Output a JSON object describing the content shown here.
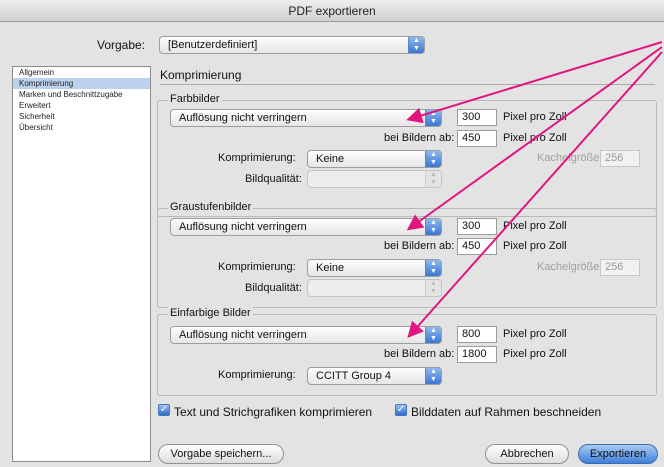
{
  "window": {
    "title": "PDF exportieren"
  },
  "preset": {
    "label": "Vorgabe:",
    "value": "[Benutzerdefiniert]"
  },
  "sidebar": {
    "items": [
      {
        "label": "Allgemein",
        "selected": false
      },
      {
        "label": "Komprimierung",
        "selected": true
      },
      {
        "label": "Marken und Beschnittzugabe",
        "selected": false
      },
      {
        "label": "Erweitert",
        "selected": false
      },
      {
        "label": "Sicherheit",
        "selected": false
      },
      {
        "label": "Übersicht",
        "selected": false
      }
    ]
  },
  "section": {
    "title": "Komprimierung"
  },
  "color_images": {
    "title": "Farbbilder",
    "downsample": "Auflösung nicht verringern",
    "ppi_value": "300",
    "ppi_unit": "Pixel pro Zoll",
    "above_label": "bei Bildern ab:",
    "above_value": "450",
    "above_unit": "Pixel pro Zoll",
    "compression_label": "Komprimierung:",
    "compression_value": "Keine",
    "tile_label": "Kachelgröße:",
    "tile_value": "256",
    "quality_label": "Bildqualität:",
    "quality_value": ""
  },
  "gray_images": {
    "title": "Graustufenbilder",
    "downsample": "Auflösung nicht verringern",
    "ppi_value": "300",
    "ppi_unit": "Pixel pro Zoll",
    "above_label": "bei Bildern ab:",
    "above_value": "450",
    "above_unit": "Pixel pro Zoll",
    "compression_label": "Komprimierung:",
    "compression_value": "Keine",
    "tile_label": "Kachelgröße:",
    "tile_value": "256",
    "quality_label": "Bildqualität:",
    "quality_value": ""
  },
  "mono_images": {
    "title": "Einfarbige Bilder",
    "downsample": "Auflösung nicht verringern",
    "ppi_value": "800",
    "ppi_unit": "Pixel pro Zoll",
    "above_label": "bei Bildern ab:",
    "above_value": "1800",
    "above_unit": "Pixel pro Zoll",
    "compression_label": "Komprimierung:",
    "compression_value": "CCITT Group 4"
  },
  "options": {
    "compress_text": {
      "label": "Text und Strichgrafiken komprimieren",
      "checked": true
    },
    "crop_images": {
      "label": "Bilddaten auf Rahmen beschneiden",
      "checked": true
    }
  },
  "buttons": {
    "save_preset": "Vorgabe speichern...",
    "cancel": "Abbrechen",
    "export": "Exportieren"
  },
  "colors": {
    "accent": "#3f80db",
    "annotation_arrow": "#e0157f"
  }
}
